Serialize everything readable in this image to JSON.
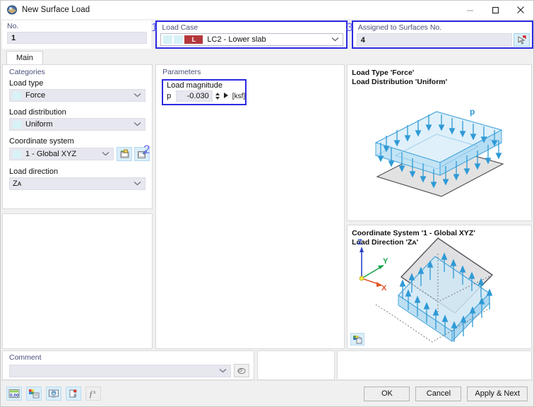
{
  "window": {
    "title": "New Surface Load",
    "icon": "surface-load-icon",
    "minimize_label": "—",
    "maximize_label": "☐",
    "close_label": "✕"
  },
  "annotations": [
    {
      "id": "1",
      "text": "1"
    },
    {
      "id": "2",
      "text": "2"
    },
    {
      "id": "3",
      "text": "3"
    }
  ],
  "top": {
    "no": {
      "label": "No.",
      "value": "1"
    },
    "load_case": {
      "label": "Load Case",
      "tag": "L",
      "value": "LC2 - Lower slab",
      "arrow_icon": "chevron-down-icon"
    },
    "assigned": {
      "label": "Assigned to Surfaces No.",
      "value": "4",
      "pick_icon": "select-surfaces-icon"
    }
  },
  "tabs": [
    {
      "label": "Main",
      "active": true
    }
  ],
  "categories": {
    "title": "Categories",
    "fields": [
      {
        "label": "Load type",
        "value": "Force",
        "icon": "chevron-down-icon"
      },
      {
        "label": "Load distribution",
        "value": "Uniform",
        "icon": "chevron-down-icon"
      },
      {
        "label": "Coordinate system",
        "value": "1 - Global XYZ",
        "icon": "chevron-down-icon"
      },
      {
        "label": "Load direction",
        "value": "Zᴀ",
        "icon": "chevron-down-icon"
      }
    ],
    "cs_buttons": [
      {
        "name": "new-coordinate-system-icon"
      },
      {
        "name": "edit-coordinate-system-icon"
      }
    ]
  },
  "parameters": {
    "title": "Parameters",
    "load_magnitude": {
      "label": "Load magnitude",
      "symbol": "p",
      "value": "-0.030",
      "unit": "[ksf]",
      "spin_up": "▲",
      "spin_down": "▼",
      "play": "▶"
    }
  },
  "preview_top": {
    "caption_line1": "Load Type 'Force'",
    "caption_line2": "Load Distribution 'Uniform'",
    "load_label": "p",
    "diagram": "surface-load-uniform-diagram"
  },
  "preview_bottom": {
    "caption_line1": "Coordinate System '1 - Global XYZ'",
    "caption_line2": "Load Direction 'Zᴀ'",
    "axes": {
      "z": "Z",
      "y": "Y",
      "x": "X"
    },
    "diagram": "load-direction-za-diagram",
    "corner_button": "render-settings-icon"
  },
  "comment": {
    "label": "Comment",
    "value": "",
    "placeholder": "",
    "arrow_icon": "chevron-down-icon",
    "button_icon": "comment-library-icon"
  },
  "footer": {
    "tools": [
      {
        "name": "units-icon",
        "enabled": true
      },
      {
        "name": "colors-icon",
        "enabled": true
      },
      {
        "name": "display-icon",
        "enabled": true
      },
      {
        "name": "info-icon",
        "enabled": true
      },
      {
        "name": "formula-icon",
        "enabled": false
      }
    ],
    "buttons": [
      {
        "name": "ok-button",
        "label": "OK"
      },
      {
        "name": "cancel-button",
        "label": "Cancel"
      },
      {
        "name": "apply-next-button",
        "label": "Apply & Next"
      }
    ]
  },
  "colors": {
    "accent_blue": "#2a2ae0",
    "label_violet": "#4a4f7a",
    "load_case_tag": "#b4373c",
    "field_fill": "#e7e7ef",
    "diagram_blue": "#2f9ad6"
  }
}
